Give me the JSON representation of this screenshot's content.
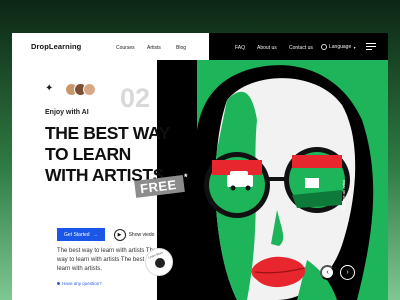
{
  "brand": {
    "logo": "DropLearning"
  },
  "nav": {
    "links": [
      "Courses",
      "Artists",
      "Blog",
      "FAQ",
      "About us",
      "Contact us"
    ],
    "language": "Language"
  },
  "hero": {
    "slide_number": "02",
    "kicker": "Enjoy with AI",
    "headline": [
      "THE BEST WAY",
      "TO LEARN",
      "WITH ARTISTS"
    ],
    "badge": "FREE",
    "badge_star": "*",
    "cta_primary": "Get Started",
    "cta_secondary": "Show viedo",
    "description": "The best way to learn with artists The best way to learn with artists The best way to learn with artists.",
    "question_link": "Have any question?",
    "vertical_caption": "Become an artist",
    "circle_badge_text": "Learn More",
    "prev_arrow": "‹",
    "next_arrow": "›",
    "cta_arrow": "→",
    "play_icon": "▶",
    "sparkle": "✦"
  },
  "colors": {
    "accent_blue": "#1a56e8",
    "illustration_green": "#1db45a",
    "lip_red": "#e8262e",
    "background_dark": "#0c2614"
  },
  "avatars": [
    {
      "color": "#c9956b"
    },
    {
      "color": "#7a4f33"
    },
    {
      "color": "#d8a886"
    }
  ]
}
